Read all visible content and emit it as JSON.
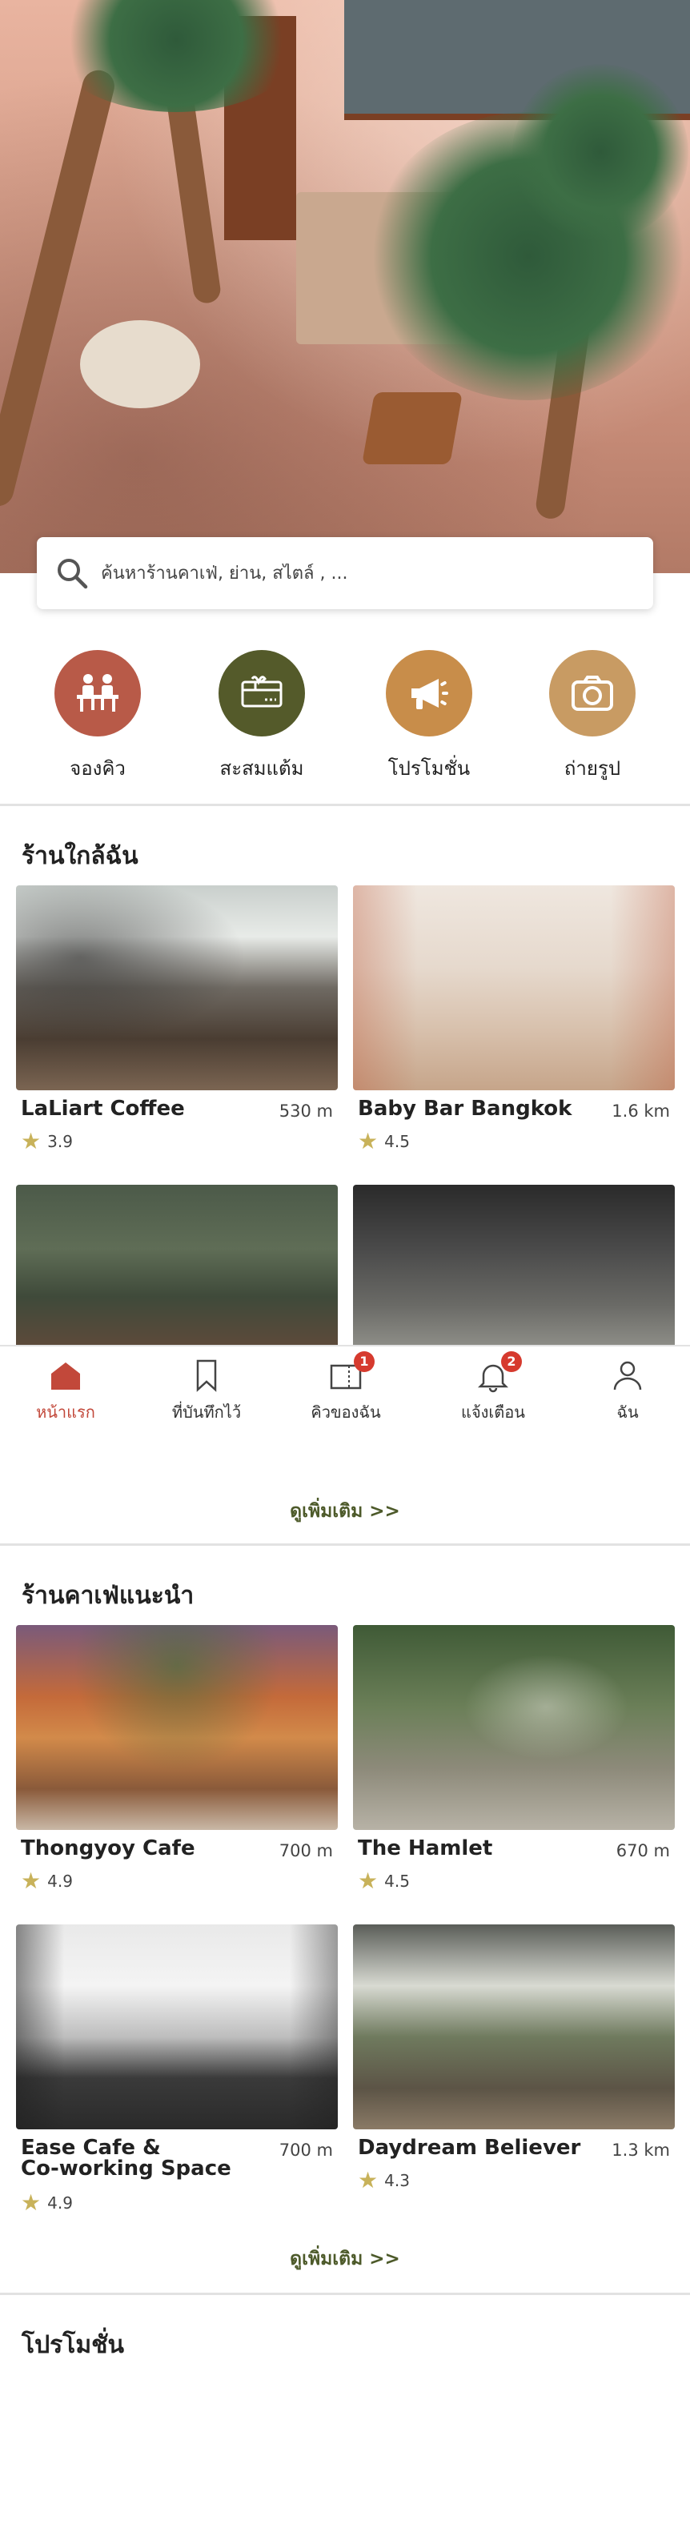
{
  "search": {
    "placeholder": "ค้นหาร้านคาเฟ่, ย่าน, สไตล์ , ..."
  },
  "quick_actions": [
    {
      "label": "จองคิว",
      "icon": "table-seat-icon",
      "color": "#b85a48"
    },
    {
      "label": "สะสมแต้ม",
      "icon": "gift-card-icon",
      "color": "#545a2a"
    },
    {
      "label": "โปรโมชั่น",
      "icon": "megaphone-icon",
      "color": "#c88d4a"
    },
    {
      "label": "ถ่ายรูป",
      "icon": "camera-icon",
      "color": "#c89b63"
    }
  ],
  "nearby": {
    "title": "ร้านใกล้ฉัน",
    "cafes": [
      {
        "name": "LaLiart Coffee",
        "distance": "530 m",
        "rating": "3.9"
      },
      {
        "name": "Baby Bar Bangkok",
        "distance": "1.6 km",
        "rating": "4.5"
      }
    ],
    "more": "ดูเพิ่มเติม >>"
  },
  "recommended": {
    "title": "ร้านคาเฟ่แนะนำ",
    "cafes": [
      {
        "name": "Thongyoy Cafe",
        "distance": "700 m",
        "rating": "4.9"
      },
      {
        "name": "The Hamlet",
        "distance": "670 m",
        "rating": "4.5"
      },
      {
        "name": "Ease Cafe &",
        "name2": "Co-working Space",
        "distance": "700 m",
        "rating": "4.9"
      },
      {
        "name": "Daydream Believer",
        "distance": "1.3 km",
        "rating": "4.3"
      }
    ],
    "more": "ดูเพิ่มเติม >>"
  },
  "promotions": {
    "title": "โปรโมชั่น"
  },
  "bottom_nav": [
    {
      "label": "หน้าแรก",
      "icon": "home-icon",
      "active": true
    },
    {
      "label": "ที่บันทึกไว้",
      "icon": "bookmark-icon"
    },
    {
      "label": "คิวของฉัน",
      "icon": "queue-icon",
      "badge": "1"
    },
    {
      "label": "แจ้งเตือน",
      "icon": "bell-icon",
      "badge": "2"
    },
    {
      "label": "ฉัน",
      "icon": "user-icon"
    }
  ],
  "colors": {
    "accent": "#c2483a",
    "olive": "#4d5a2a",
    "star": "#c8b25a",
    "badge": "#d63a2e"
  }
}
